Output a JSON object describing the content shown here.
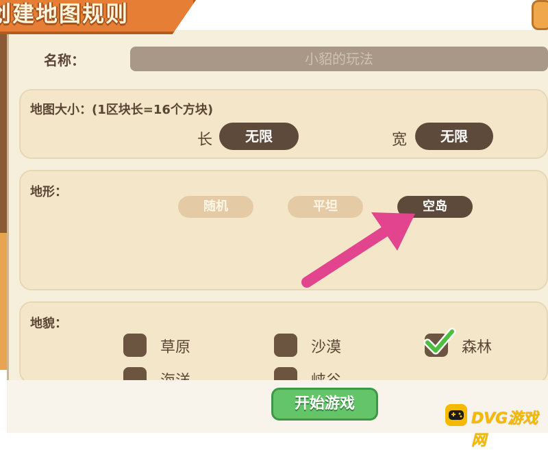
{
  "window": {
    "title": "创建地图规则"
  },
  "name_row": {
    "label": "名称：",
    "value": "小貂的玩法"
  },
  "map_size": {
    "title": "地图大小：(1区块长=16个方块)",
    "length_label": "长",
    "length_value": "无限",
    "width_label": "宽",
    "width_value": "无限"
  },
  "terrain": {
    "title": "地形：",
    "options": [
      {
        "label": "随机",
        "selected": false
      },
      {
        "label": "平坦",
        "selected": false
      },
      {
        "label": "空岛",
        "selected": true
      }
    ]
  },
  "landform": {
    "title": "地貌：",
    "items": [
      {
        "label": "草原",
        "checked": false
      },
      {
        "label": "沙漠",
        "checked": false
      },
      {
        "label": "森林",
        "checked": true
      },
      {
        "label": "海洋",
        "checked": false
      },
      {
        "label": "峡谷",
        "checked": false
      }
    ]
  },
  "footer": {
    "start_label": "开始游戏"
  },
  "watermark": {
    "text": "DVG游戏网"
  },
  "colors": {
    "accent_orange": "#e67f35",
    "panel_bg": "#f3e6c9",
    "selected_dark": "#5e4a3a",
    "start_green": "#64c46a",
    "arrow_pink": "#e2458d"
  }
}
